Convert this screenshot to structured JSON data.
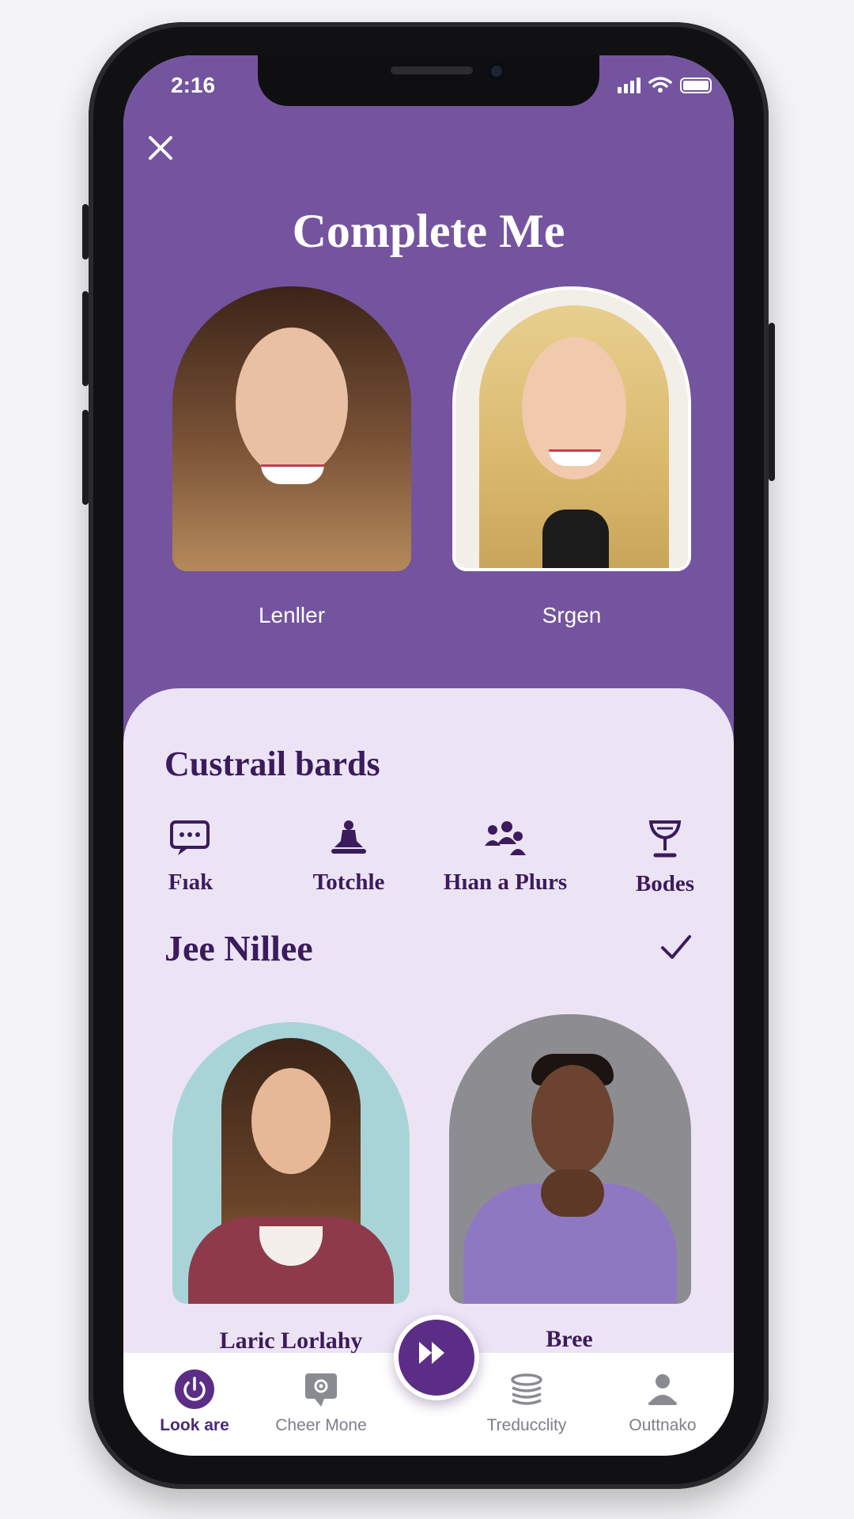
{
  "status_bar": {
    "time": "2:16"
  },
  "header": {
    "title": "Complete Me"
  },
  "top_profiles": [
    {
      "name": "Lenller"
    },
    {
      "name": "Srgen"
    }
  ],
  "section1": {
    "title": "Custrail bards",
    "items": [
      {
        "label": "Fıak",
        "icon": "chat-icon"
      },
      {
        "label": "Totchle",
        "icon": "figure-icon"
      },
      {
        "label": "Hıan a Plurs",
        "icon": "group-icon"
      },
      {
        "label": "Bodes",
        "icon": "glass-icon"
      }
    ]
  },
  "section2": {
    "title": "Jee Nillee",
    "people": [
      {
        "name": "Laric Lorlahy"
      },
      {
        "name": "Bree"
      }
    ]
  },
  "nav": {
    "items": [
      {
        "label": "Look are",
        "icon": "power-icon",
        "active": true
      },
      {
        "label": "Cheer Mone",
        "icon": "settings-chat-icon"
      },
      {
        "label": "Treducclity",
        "icon": "stack-icon"
      },
      {
        "label": "Outtnako",
        "icon": "user-icon"
      }
    ]
  },
  "colors": {
    "primary": "#74549f",
    "dark_purple": "#3b1b5c",
    "card_bg": "#ece4f5"
  }
}
